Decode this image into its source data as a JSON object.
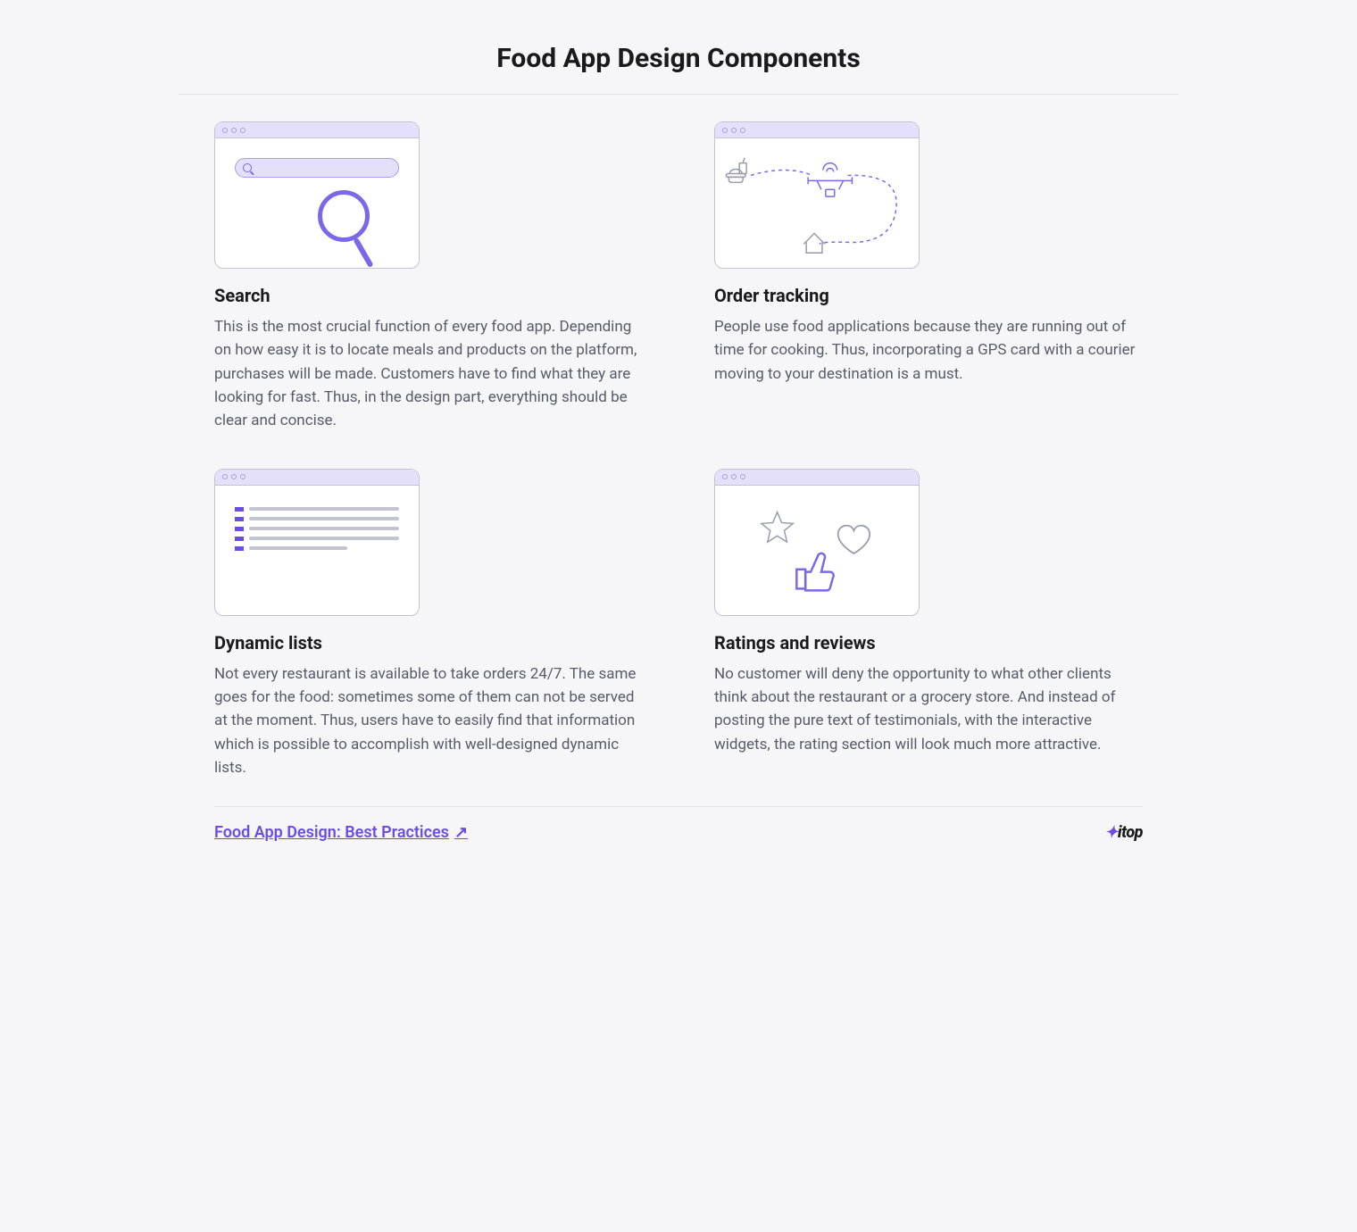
{
  "title": "Food App Design Components",
  "cards": [
    {
      "title": "Search",
      "desc": "This is the most crucial function of every food app. Depending on how easy it is to locate meals and products on the platform, purchases will be made. Customers have to find what they are looking for fast. Thus, in the design part, everything should be clear and concise."
    },
    {
      "title": "Order tracking",
      "desc": "People use food applications because they are running out of time for cooking. Thus, incorporating a GPS card with a courier moving to your destination is a must."
    },
    {
      "title": "Dynamic lists",
      "desc": "Not every restaurant is available to take orders 24/7. The same goes for the food: sometimes some of them can not be served at the moment. Thus, users have to easily find that information which is possible to accomplish with well-designed dynamic lists."
    },
    {
      "title": "Ratings and reviews",
      "desc": "No customer will deny the opportunity to what other clients think about the restaurant or a grocery store. And instead of posting the pure text of testimonials, with the interactive widgets, the rating section will look much more attractive."
    }
  ],
  "footer": {
    "link_label": "Food App Design: Best Practices",
    "logo": "itop"
  }
}
